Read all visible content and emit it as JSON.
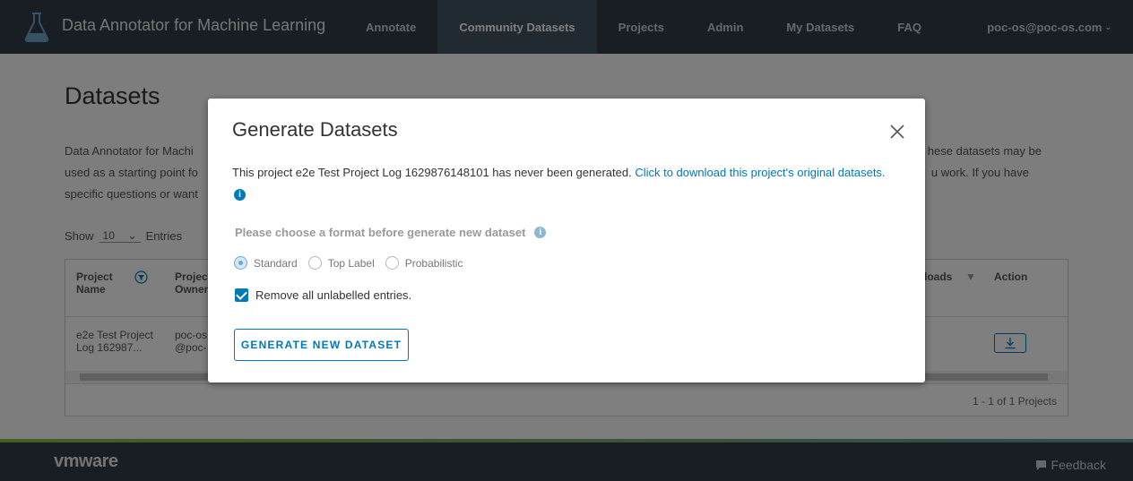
{
  "header": {
    "app_title": "Data Annotator for Machine Learning",
    "nav": [
      "Annotate",
      "Community Datasets",
      "Projects",
      "Admin",
      "My Datasets",
      "FAQ"
    ],
    "active_nav": "Community Datasets",
    "user": "poc-os@poc-os.com"
  },
  "page": {
    "title": "Datasets",
    "description_line1": "Data Annotator for Machi",
    "description_line1_tail": "hese datasets may be",
    "description_line2": "used as a starting point fo",
    "description_line2_tail": "u work. If you have",
    "description_line3": "specific questions or want",
    "show_label": "Show",
    "entries_value": "10",
    "entries_label": "Entries"
  },
  "grid": {
    "columns": {
      "project_name": "Project Name",
      "project_owner": "Project Owner",
      "downloads": "loads",
      "action": "Action"
    },
    "rows": [
      {
        "project_name": "e2e Test Project Log 162987...",
        "project_owner": "poc-os@poc-os.com"
      }
    ],
    "pager_text": "1 - 1 of 1 Projects"
  },
  "footer": {
    "logo": "vmware",
    "feedback": "Feedback"
  },
  "modal": {
    "title": "Generate Datasets",
    "message": "This project e2e Test Project Log 1629876148101 has never been generated. ",
    "link_text": "Click to download this project's original datasets.",
    "format_label": "Please choose a format before generate new dataset",
    "formats": [
      "Standard",
      "Top Label",
      "Probabilistic"
    ],
    "selected_format": "Standard",
    "remove_unlabelled_label": "Remove all unlabelled entries.",
    "remove_unlabelled_checked": true,
    "generate_button": "GENERATE NEW DATASET"
  },
  "colors": {
    "header_bg": "#313c47",
    "accent": "#0079b8"
  }
}
